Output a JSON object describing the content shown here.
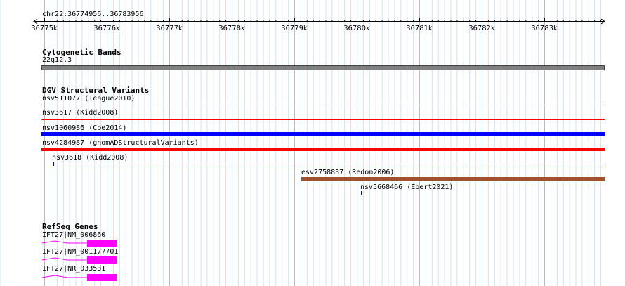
{
  "ruler": {
    "position_label": "chr22:36774956..36783956",
    "ticks": [
      "36775k",
      "36776k",
      "36777k",
      "36778k",
      "36779k",
      "36780k",
      "36781k",
      "36782k",
      "36783k"
    ]
  },
  "tracks": {
    "cytogenetic": {
      "title": "Cytogenetic Bands",
      "band_label": "22q12.3",
      "band_color": "#808080"
    },
    "dgv": {
      "title": "DGV Structural Variants",
      "variants": [
        {
          "label": "nsv511077 (Teague2010)",
          "color": "#000000"
        },
        {
          "label": "nsv3617 (Kidd2008)",
          "color": "#ff0000"
        },
        {
          "label": "nsv1060986 (Coe2014)",
          "color": "#0000ff"
        },
        {
          "label": "nsv4284987 (gnomADStructuralVariants)",
          "color": "#ff0000"
        },
        {
          "label": "nsv3618 (Kidd2008)",
          "color": "#0000ff"
        },
        {
          "label": "esv2758837 (Redon2006)",
          "color": "#a0522d"
        },
        {
          "label": "nsv5668466 (Ebert2021)",
          "color": "#0000ff"
        }
      ]
    },
    "refseq": {
      "title": "RefSeq Genes",
      "genes": [
        {
          "label": "IFT27|NM_006860",
          "color": "#ff00ff"
        },
        {
          "label": "IFT27|NM_001177701",
          "color": "#ff00ff"
        },
        {
          "label": "IFT27|NR_033531",
          "color": "#ff00ff"
        }
      ]
    }
  }
}
